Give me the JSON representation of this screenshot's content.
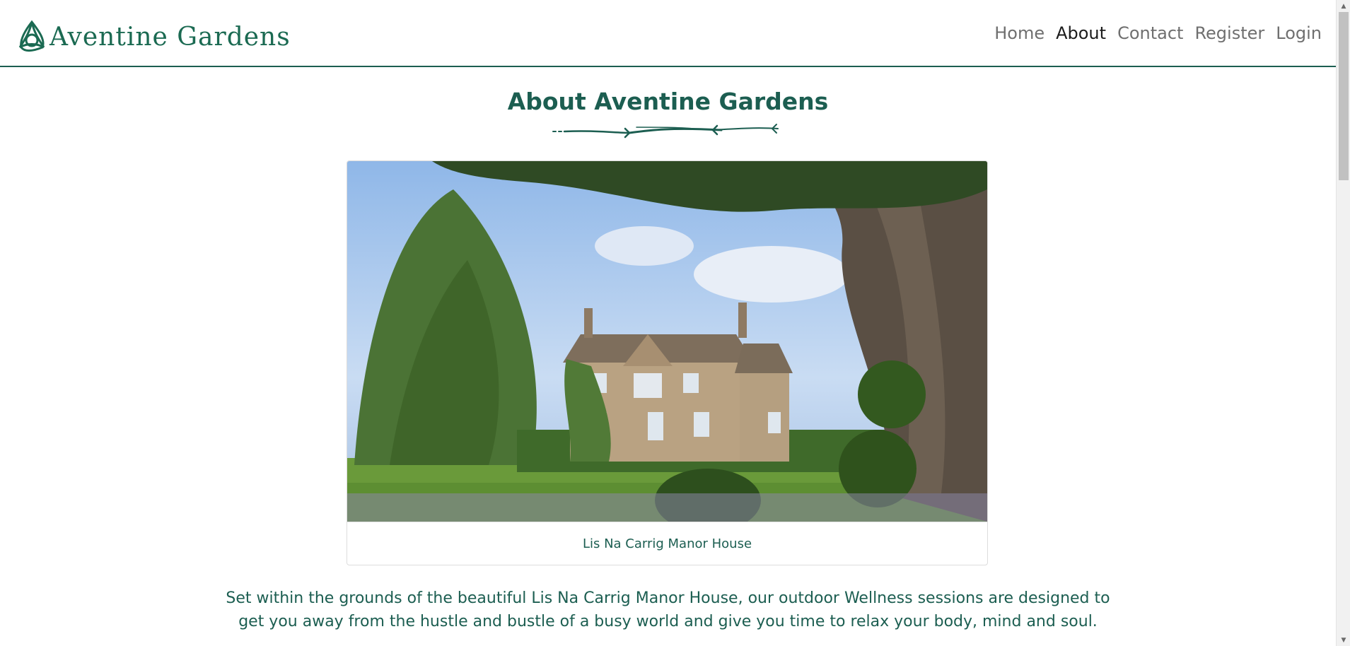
{
  "brand": {
    "name": "Aventine Gardens",
    "icon": "celtic-knot-icon",
    "color": "#1b6a52"
  },
  "nav": {
    "items": [
      {
        "label": "Home",
        "active": false
      },
      {
        "label": "About",
        "active": true
      },
      {
        "label": "Contact",
        "active": false
      },
      {
        "label": "Register",
        "active": false
      },
      {
        "label": "Login",
        "active": false
      }
    ]
  },
  "main": {
    "title": "About Aventine Gardens",
    "card": {
      "caption": "Lis Na Carrig Manor House"
    },
    "paragraph": "Set within the grounds of the beautiful Lis Na Carrig Manor House, our outdoor Wellness sessions are designed to get you away from the hustle and bustle of a busy world and give you time to relax your body, mind and soul."
  },
  "theme": {
    "accent": "#1c5e51",
    "nav_inactive": "#6f6f6f",
    "nav_active": "#1b1b1b"
  }
}
